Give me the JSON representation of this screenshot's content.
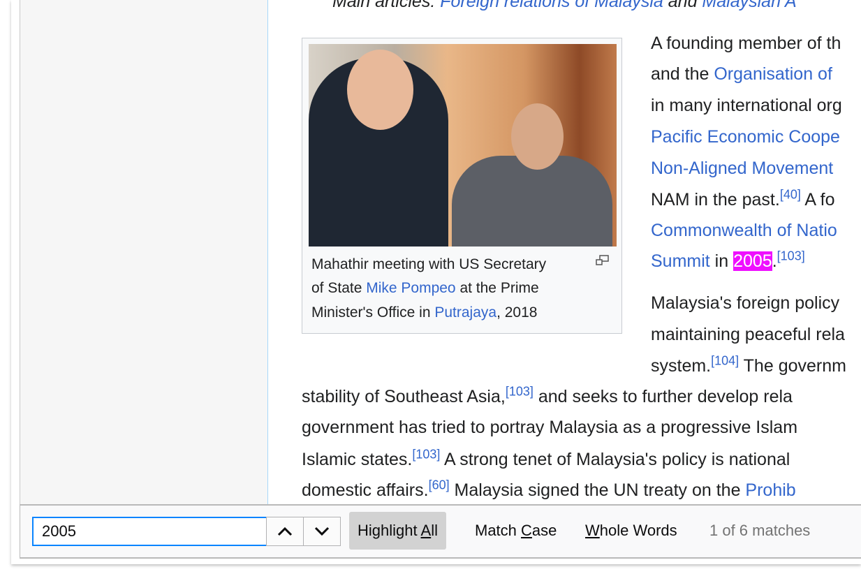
{
  "article": {
    "hatnote": {
      "prefix": "Main articles: ",
      "link1": "Foreign relations of Malaysia",
      "and": " and ",
      "link2": "Malaysian A"
    },
    "caption": {
      "t1": "Mahathir meeting with US Secretary",
      "t2": "of State ",
      "link1": "Mike Pompeo",
      "t3": " at the Prime",
      "t4": "Minister's Office in ",
      "link2": "Putrajaya",
      "t5": ", 2018"
    },
    "lines": {
      "l1": "A founding member of th",
      "l2a": "and the ",
      "l2link": "Organisation of",
      "l3": "in many international org",
      "l4link": "Pacific Economic Coope",
      "l5link": "Non-Aligned Movement",
      "l6a": "NAM in the past.",
      "l6ref": "[40]",
      "l6b": " A fo",
      "l7link": "Commonwealth of Natio",
      "l8link": "Summit",
      "l8a": " in ",
      "l8hl": "2005",
      "l8b": ".",
      "l8ref": "[103]",
      "l9": "Malaysia's foreign policy",
      "l10": "maintaining peaceful rela",
      "l11a": "system.",
      "l11ref": "[104]",
      "l11b": " The governm",
      "l12a": "stability of Southeast Asia,",
      "l12ref": "[103]",
      "l12b": " and seeks to further develop rela",
      "l13": "government has tried to portray Malaysia as a progressive Islam",
      "l14a": "Islamic states.",
      "l14ref": "[103]",
      "l14b": " A strong tenet of Malaysia's policy is national",
      "l15a": "domestic affairs.",
      "l15ref": "[60]",
      "l15b": " Malaysia signed the UN treaty on the ",
      "l15link": "Prohib"
    }
  },
  "findbar": {
    "query": "2005",
    "prev_icon": "chevron-up-icon",
    "next_icon": "chevron-down-icon",
    "highlight_all": {
      "pre": "Highlight ",
      "key": "A",
      "post": "ll",
      "active": true
    },
    "match_case": {
      "pre": "Match ",
      "key": "C",
      "post": "ase"
    },
    "whole_words": {
      "key": "W",
      "post": "hole Words"
    },
    "status": "1 of 6 matches"
  },
  "colors": {
    "link": "#3366cc",
    "highlight": "#ef0fff",
    "focus": "#0a84ff"
  }
}
